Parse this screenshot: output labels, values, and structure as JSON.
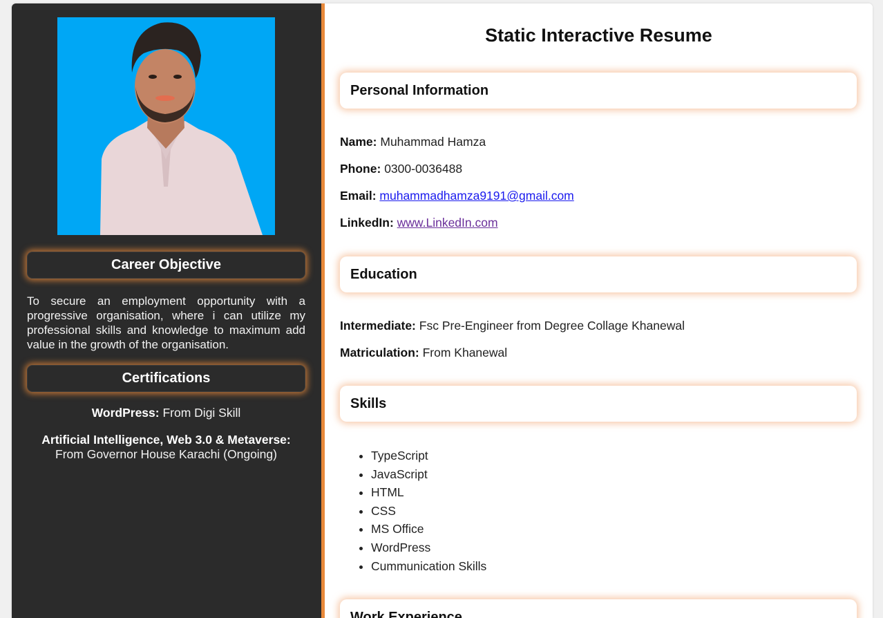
{
  "sidebar": {
    "career_heading": "Career Objective",
    "career_text": "To secure an employment opportunity with a progressive organisation, where i can utilize my professional skills and knowledge to maximum add value in the growth of the organisation.",
    "certifications_heading": "Certifications",
    "certifications": [
      {
        "label": "WordPress:",
        "value": "From Digi Skill"
      },
      {
        "label": "Artificial Intelligence, Web 3.0 & Metaverse:",
        "value": "From Governor House Karachi (Ongoing)"
      }
    ]
  },
  "main": {
    "title": "Static Interactive Resume",
    "personal": {
      "heading": "Personal Information",
      "name_label": "Name:",
      "name_value": "Muhammad Hamza",
      "phone_label": "Phone:",
      "phone_value": "0300-0036488",
      "email_label": "Email:",
      "email_value": "muhammadhamza9191@gmail.com",
      "linkedin_label": "LinkedIn:",
      "linkedin_value": "www.LinkedIn.com"
    },
    "education": {
      "heading": "Education",
      "items": [
        {
          "label": "Intermediate:",
          "value": "Fsc Pre-Engineer from Degree Collage Khanewal"
        },
        {
          "label": "Matriculation:",
          "value": "From Khanewal"
        }
      ]
    },
    "skills": {
      "heading": "Skills",
      "items": [
        "TypeScript",
        "JavaScript",
        "HTML",
        "CSS",
        "MS Office",
        "WordPress",
        "Cummunication Skills"
      ]
    },
    "work": {
      "heading": "Work Experience"
    }
  },
  "colors": {
    "sidebar_bg": "#2b2b2b",
    "accent": "#e8893a",
    "photo_bg": "#00a7f5",
    "link": "#1a1aee",
    "visited_link": "#6a2f9a"
  }
}
